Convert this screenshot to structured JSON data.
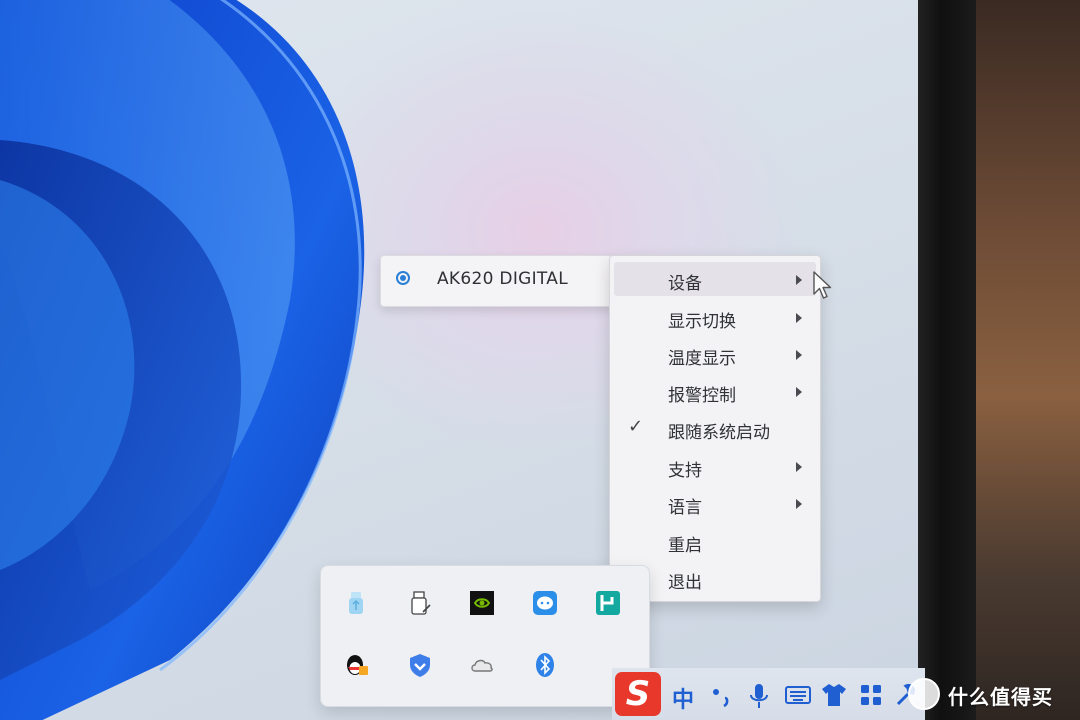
{
  "device_submenu": {
    "selected_device": "AK620 DIGITAL"
  },
  "context_menu": {
    "items": [
      {
        "label": "设备",
        "has_submenu": true,
        "checked": false,
        "highlighted": true
      },
      {
        "label": "显示切换",
        "has_submenu": true,
        "checked": false,
        "highlighted": false
      },
      {
        "label": "温度显示",
        "has_submenu": true,
        "checked": false,
        "highlighted": false
      },
      {
        "label": "报警控制",
        "has_submenu": true,
        "checked": false,
        "highlighted": false
      },
      {
        "label": "跟随系统启动",
        "has_submenu": false,
        "checked": true,
        "highlighted": false
      },
      {
        "label": "支持",
        "has_submenu": true,
        "checked": false,
        "highlighted": false
      },
      {
        "label": "语言",
        "has_submenu": true,
        "checked": false,
        "highlighted": false
      },
      {
        "label": "重启",
        "has_submenu": false,
        "checked": false,
        "highlighted": false
      },
      {
        "label": "退出",
        "has_submenu": false,
        "checked": false,
        "highlighted": false
      }
    ]
  },
  "tray_flyout": {
    "icons": [
      "usb-device-icon",
      "usb-drive-icon",
      "nvidia-icon",
      "chat-bubble-icon",
      "app-green-icon",
      "qq-penguin-icon",
      "shield-icon",
      "onedrive-cloud-icon",
      "bluetooth-icon"
    ]
  },
  "taskbar": {
    "ime_logo": "S",
    "ime_mode": "中",
    "icons": [
      "ime-punctuation-icon",
      "microphone-icon",
      "keyboard-icon",
      "skin-icon",
      "toolbox-icon",
      "settings-icon"
    ]
  },
  "watermark": {
    "text": "什么值得买"
  },
  "colors": {
    "accent": "#2a7fd6",
    "wallpaper_blue": "#1a5fe0",
    "ime_red": "#e8382b"
  }
}
